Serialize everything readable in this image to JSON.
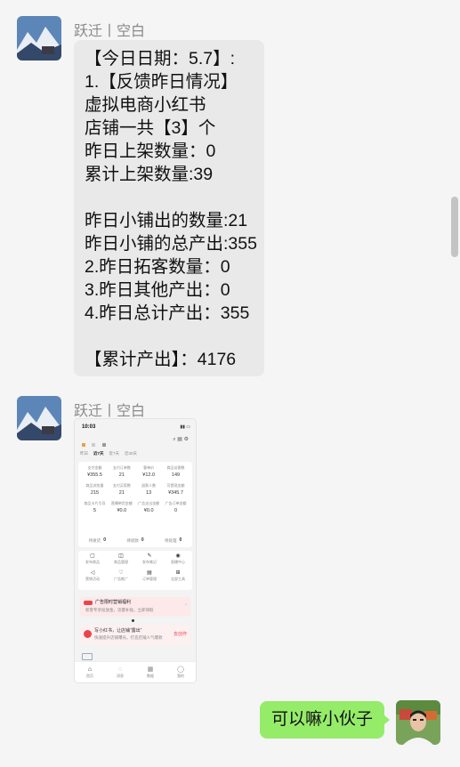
{
  "messages": {
    "first": {
      "sender": "跃迁丨空白",
      "lines": [
        "【今日日期：5.7】:",
        "1.【反馈昨日情况】",
        "虚拟电商小红书",
        "店铺一共【3】个",
        "昨日上架数量：0",
        "累计上架数量:39",
        "",
        "昨日小铺出的数量:21",
        "昨日小铺的总产出:355",
        "2.昨日拓客数量：0",
        "3.昨日其他产出：0",
        "4.昨日总计产出：355",
        "",
        "【累计产出】：4176"
      ]
    },
    "second": {
      "sender": "跃迁丨空白",
      "screenshot": {
        "time": "10:03",
        "tabs": [
          "昨日",
          "近7天",
          "近7天",
          "近30天"
        ],
        "stats_row1_labels": [
          "支付金额",
          "支付订单数",
          "客单价",
          "商品访客数"
        ],
        "stats_row1_values": [
          "¥355.5",
          "21",
          "¥12.0",
          "149"
        ],
        "stats_row2_labels": [
          "商品浏览量",
          "支付买家数",
          "退款人数",
          "可提现金额"
        ],
        "stats_row2_values": [
          "215",
          "21",
          "13",
          "¥345.7"
        ],
        "stats_row3_labels": [
          "商品卡片引导",
          "直播带货金额",
          "广告支出金额",
          "广告订单金额"
        ],
        "stats_row3_values": [
          "5",
          "¥0.0",
          "¥0.0",
          "0"
        ],
        "orders": [
          {
            "label": "待发货",
            "value": "0"
          },
          {
            "label": "待退款",
            "value": "0"
          },
          {
            "label": "待处理",
            "value": "0"
          }
        ],
        "tools": [
          "发布商品",
          "商品管理",
          "发布笔记",
          "直播中心",
          "营销活动",
          "广告推广",
          "订单管理",
          "全部工具"
        ],
        "banner1_title": "广告限时营销福利",
        "banner1_sub": "新客专享投放金，流量补贴，立即领取",
        "banner2_title": "写小红书，让店铺“露出”",
        "banner2_sub": "快速提升店铺曝光，打造店铺人气爆款",
        "banner2_button": "去创作",
        "nav": [
          "首页",
          "消息",
          "数据",
          "我的"
        ]
      }
    },
    "reply": {
      "text": "可以嘛小伙子"
    }
  },
  "colors": {
    "page_bg": "#f5f5f5",
    "incoming_bubble": "#e9e9ea",
    "outgoing_bubble": "#95ec69",
    "sender_name": "#8a8a8a",
    "shot_accent": "#e8464d"
  }
}
